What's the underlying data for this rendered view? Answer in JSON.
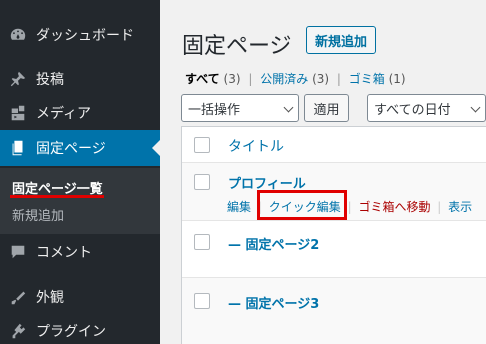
{
  "sidebar": {
    "items": [
      {
        "label": "ダッシュボード",
        "icon": "dashboard-icon"
      },
      {
        "label": "投稿",
        "icon": "pin-icon"
      },
      {
        "label": "メディア",
        "icon": "media-icon"
      },
      {
        "label": "固定ページ",
        "icon": "pages-icon",
        "active": true
      },
      {
        "label": "コメント",
        "icon": "comments-icon"
      },
      {
        "label": "外観",
        "icon": "appearance-icon"
      },
      {
        "label": "プラグイン",
        "icon": "plugins-icon"
      }
    ],
    "submenu": {
      "current": "固定ページ一覧",
      "add_new": "新規追加"
    }
  },
  "header": {
    "title": "固定ページ",
    "add_new_button": "新規追加"
  },
  "filters": {
    "all": {
      "label": "すべて",
      "count": "(3)"
    },
    "published": {
      "label": "公開済み",
      "count": "(3)"
    },
    "trash": {
      "label": "ゴミ箱",
      "count": "(1)"
    },
    "separator": "|"
  },
  "toolbar": {
    "bulk_action": "一括操作",
    "apply": "適用",
    "dates": "すべての日付"
  },
  "table": {
    "column_title": "タイトル",
    "rows": [
      {
        "title": "プロフィール"
      },
      {
        "title": "— 固定ページ2"
      },
      {
        "title": "— 固定ページ3"
      }
    ],
    "row_actions": {
      "edit": "編集",
      "quick_edit": "クイック編集",
      "trash": "ゴミ箱へ移動",
      "view": "表示",
      "separator": "|"
    }
  },
  "colors": {
    "sidebar_bg": "#23282d",
    "active_bg": "#0073aa",
    "link": "#0073aa",
    "trash_link": "#aa0000",
    "highlight": "#e00000"
  }
}
